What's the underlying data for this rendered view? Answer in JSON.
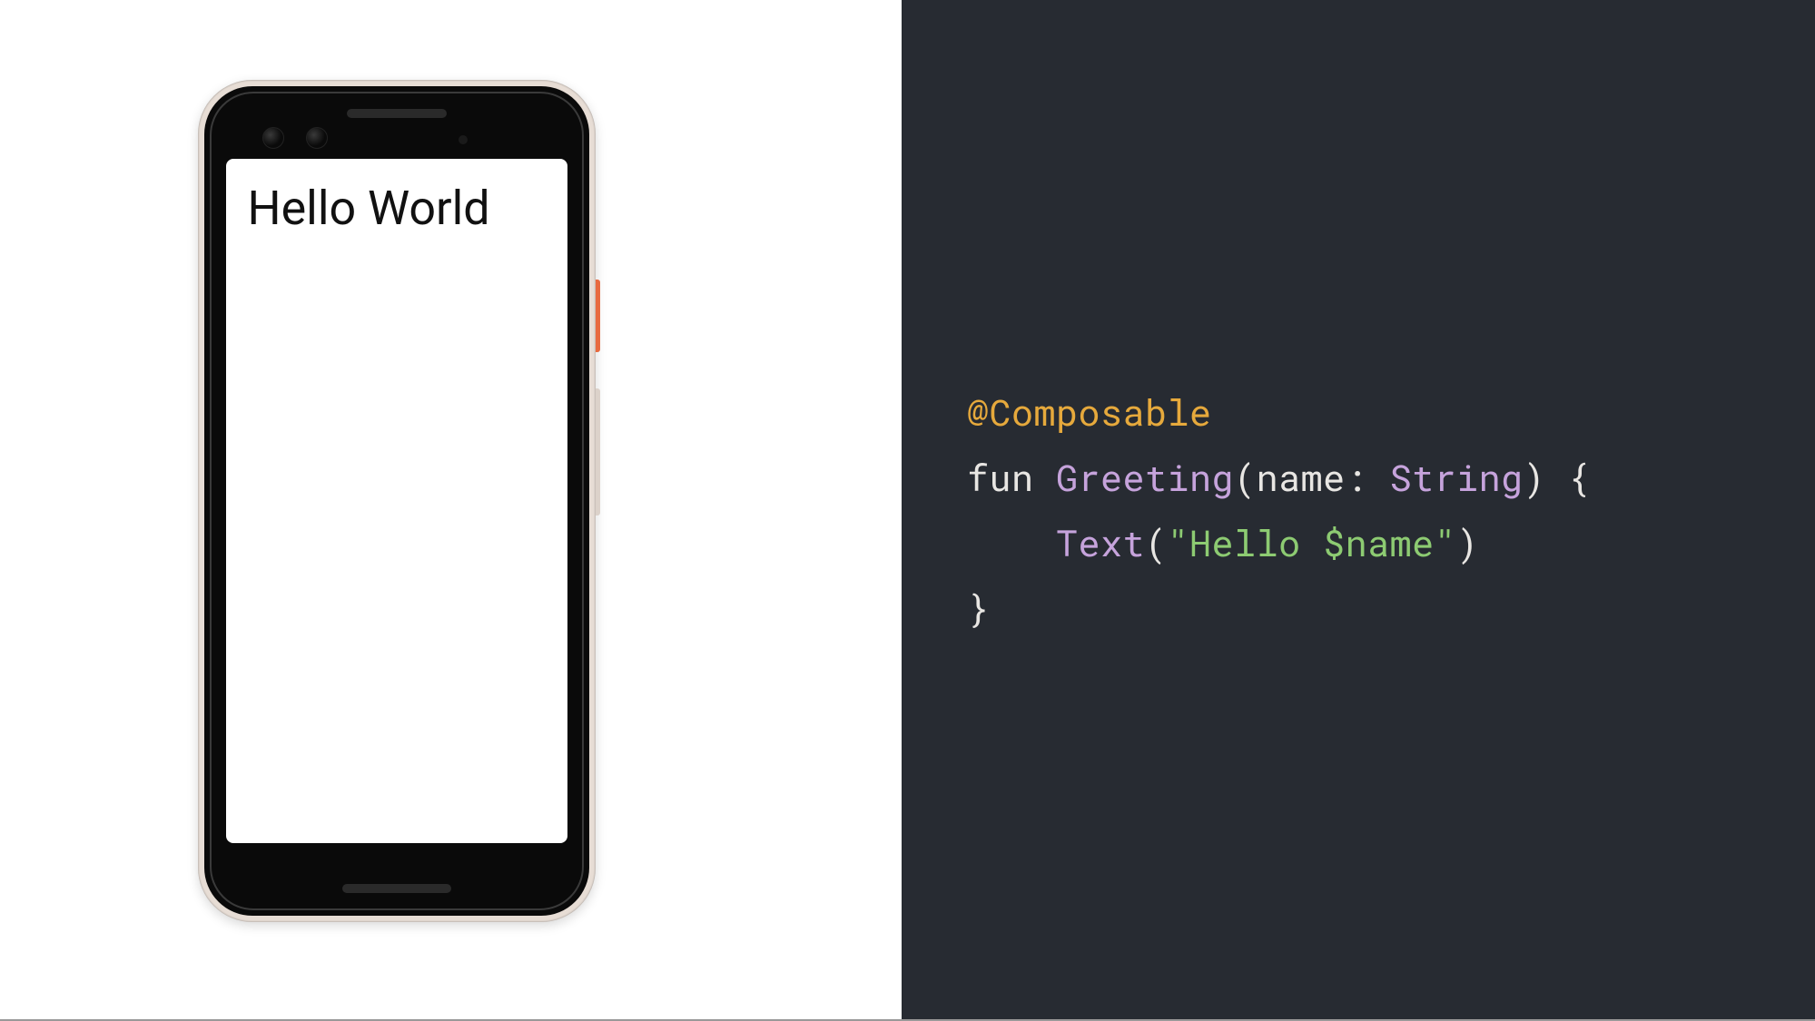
{
  "phone": {
    "screen_text": "Hello World"
  },
  "code": {
    "annotation": "@Composable",
    "keyword_fun": "fun ",
    "func_name": "Greeting",
    "open_paren": "(",
    "param_name": "name",
    "colon": ": ",
    "type_name": "String",
    "close_paren": ")",
    "space_brace": " {",
    "indent": "    ",
    "call_name": "Text",
    "call_open": "(",
    "string_literal": "\"Hello $name\"",
    "call_close": ")",
    "close_brace": "}"
  }
}
